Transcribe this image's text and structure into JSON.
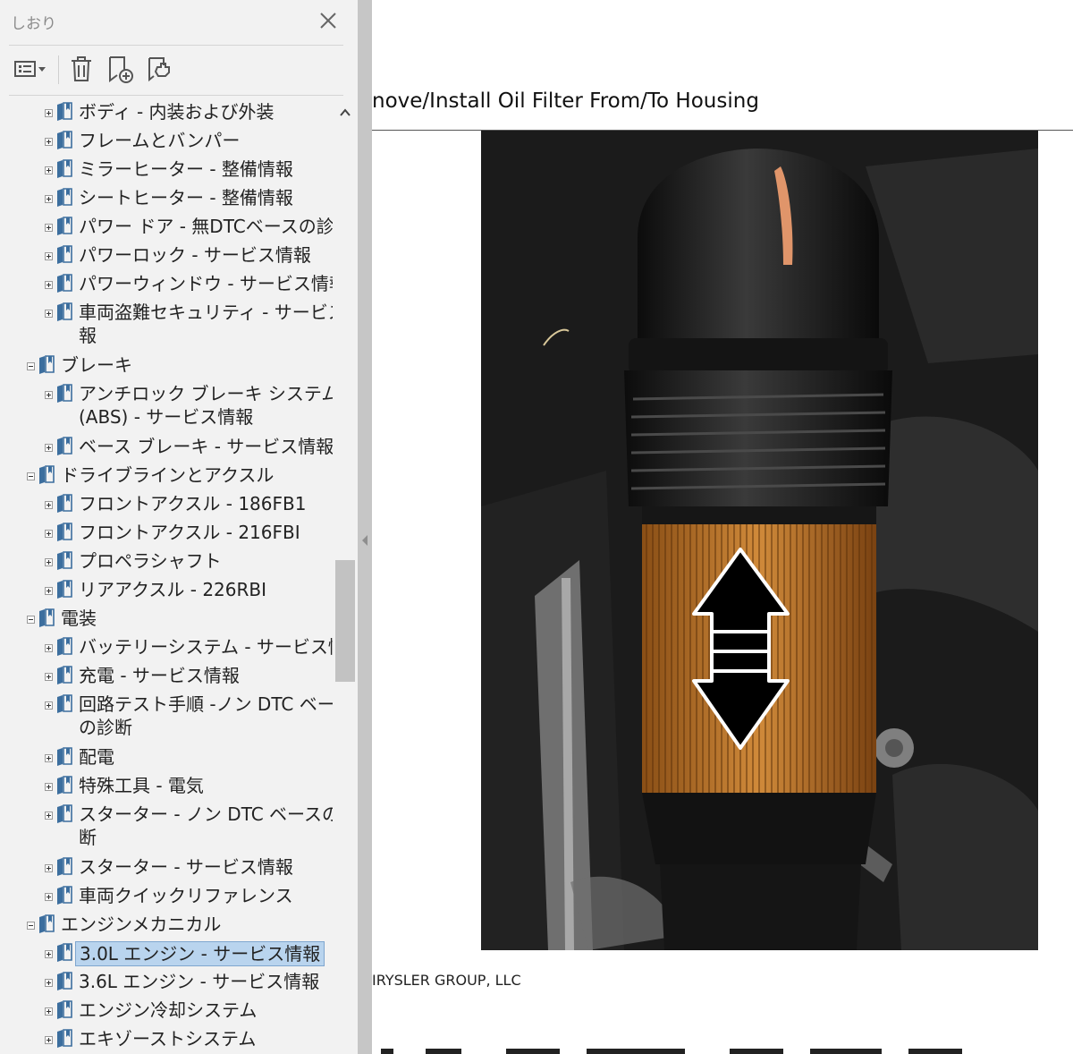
{
  "panel": {
    "title": "しおり",
    "close_glyph": "✕",
    "toolbar": {
      "options_icon": "list-options-icon",
      "delete_icon": "trash-icon",
      "new_bookmark_icon": "new-bookmark-icon",
      "find_bookmark_icon": "find-current-bookmark-icon"
    }
  },
  "tree": {
    "items": [
      {
        "label": "ボディ - 内装および外装",
        "level": 2,
        "expanded": false
      },
      {
        "label": "フレームとバンパー",
        "level": 2,
        "expanded": false
      },
      {
        "label": "ミラーヒーター - 整備情報",
        "level": 2,
        "expanded": false
      },
      {
        "label": "シートヒーター - 整備情報",
        "level": 2,
        "expanded": false
      },
      {
        "label": "パワー ドア - 無DTCベースの診断",
        "level": 2,
        "expanded": false
      },
      {
        "label": "パワーロック - サービス情報",
        "level": 2,
        "expanded": false
      },
      {
        "label": "パワーウィンドウ - サービス情報",
        "level": 2,
        "expanded": false
      },
      {
        "label": "車両盗難セキュリティ - サービス情",
        "label2": "報",
        "level": 2,
        "expanded": false
      },
      {
        "label": "ブレーキ",
        "level": 1,
        "expanded": true
      },
      {
        "label": "アンチロック ブレーキ システム",
        "label2": "(ABS) - サービス情報",
        "level": 2,
        "expanded": false
      },
      {
        "label": "ベース ブレーキ - サービス情報",
        "level": 2,
        "expanded": false
      },
      {
        "label": "ドライブラインとアクスル",
        "level": 1,
        "expanded": true
      },
      {
        "label": "フロントアクスル - 186FB1",
        "level": 2,
        "expanded": false
      },
      {
        "label": "フロントアクスル - 216FBI",
        "level": 2,
        "expanded": false
      },
      {
        "label": "プロペラシャフト",
        "level": 2,
        "expanded": false
      },
      {
        "label": "リアアクスル - 226RBI",
        "level": 2,
        "expanded": false
      },
      {
        "label": "電装",
        "level": 1,
        "expanded": true
      },
      {
        "label": "バッテリーシステム - サービス情報",
        "level": 2,
        "expanded": false
      },
      {
        "label": "充電 - サービス情報",
        "level": 2,
        "expanded": false
      },
      {
        "label": "回路テスト手順 -ノン DTC ベース",
        "label2": "の診断",
        "level": 2,
        "expanded": false
      },
      {
        "label": "配電",
        "level": 2,
        "expanded": false
      },
      {
        "label": "特殊工具 - 電気",
        "level": 2,
        "expanded": false
      },
      {
        "label": "スターター - ノン DTC ベースの診",
        "label2": "断",
        "level": 2,
        "expanded": false
      },
      {
        "label": "スターター - サービス情報",
        "level": 2,
        "expanded": false
      },
      {
        "label": "車両クイックリファレンス",
        "level": 2,
        "expanded": false
      },
      {
        "label": "エンジンメカニカル",
        "level": 1,
        "expanded": true
      },
      {
        "label": "3.0L エンジン - サービス情報",
        "level": 2,
        "expanded": false,
        "selected": true
      },
      {
        "label": "3.6L エンジン - サービス情報",
        "level": 2,
        "expanded": false
      },
      {
        "label": "エンジン冷却システム",
        "level": 2,
        "expanded": false
      },
      {
        "label": "エキゾーストシステム",
        "level": 2,
        "expanded": false
      }
    ]
  },
  "document": {
    "heading": "nove/Install Oil Filter From/To Housing",
    "footer": "IRYSLER GROUP, LLC",
    "figure_icon": "double-headed-arrow-icon"
  },
  "colors": {
    "panel_bg": "#f2f2f2",
    "selection_bg": "#b9d4ee",
    "selection_border": "#7fa6cf",
    "bookmark_icon": "#3c6e9e"
  }
}
